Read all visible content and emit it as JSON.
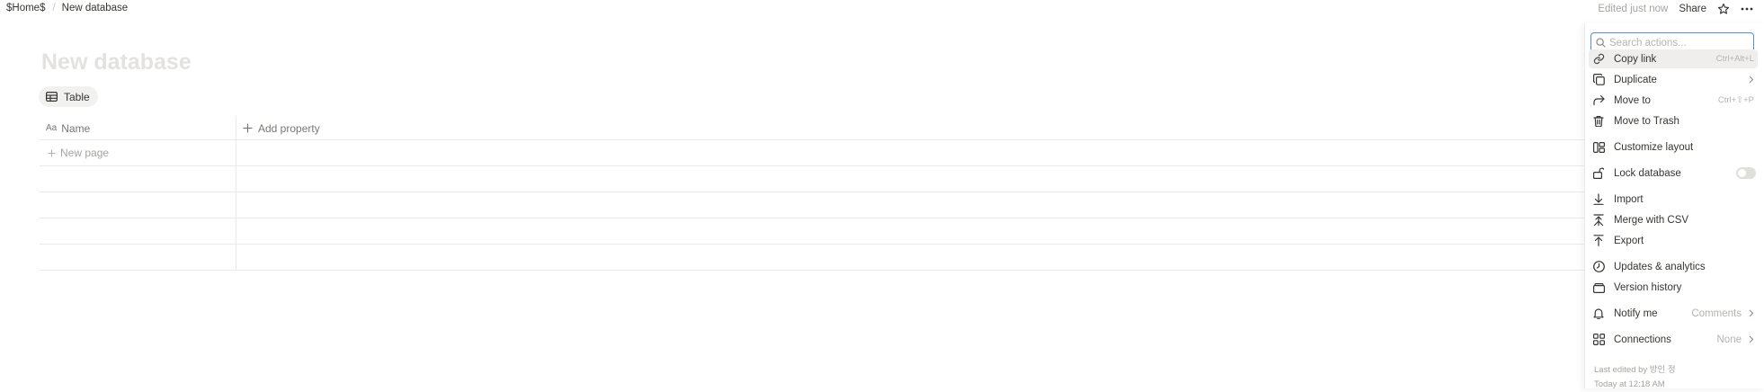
{
  "breadcrumb": {
    "home": "$Home$",
    "current": "New database"
  },
  "topbar": {
    "edited": "Edited just now",
    "share": "Share"
  },
  "page": {
    "title": "New database"
  },
  "view_tab": {
    "label": "Table"
  },
  "table": {
    "name_header": "Name",
    "name_header_icon": "Aa",
    "add_property": "Add property",
    "new_page": "New page"
  },
  "menu": {
    "search_placeholder": "Search actions...",
    "items": [
      {
        "label": "Copy link",
        "icon": "link-icon",
        "shortcut": "Ctrl+Alt+L"
      },
      {
        "label": "Duplicate",
        "icon": "duplicate-icon"
      },
      {
        "label": "Move to",
        "icon": "move-to-icon",
        "shortcut": "Ctrl+⇧+P"
      },
      {
        "label": "Move to Trash",
        "icon": "trash-icon"
      },
      {
        "label": "Customize layout",
        "icon": "layout-icon"
      },
      {
        "label": "Lock database",
        "icon": "lock-icon"
      },
      {
        "label": "Import",
        "icon": "import-icon"
      },
      {
        "label": "Merge with CSV",
        "icon": "merge-icon"
      },
      {
        "label": "Export",
        "icon": "export-icon"
      },
      {
        "label": "Updates & analytics",
        "icon": "clock-icon"
      },
      {
        "label": "Version history",
        "icon": "history-icon"
      },
      {
        "label": "Notify me",
        "icon": "bell-icon",
        "value": "Comments"
      },
      {
        "label": "Connections",
        "icon": "connections-icon",
        "value": "None"
      }
    ],
    "footer": {
      "last_edited": "Last edited by 방인 정",
      "time": "Today at 12:18 AM"
    }
  }
}
